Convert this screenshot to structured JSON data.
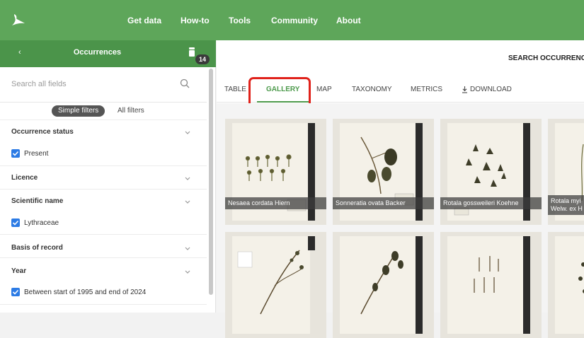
{
  "topnav": {
    "items": [
      "Get data",
      "How-to",
      "Tools",
      "Community",
      "About"
    ]
  },
  "sidebar": {
    "back_glyph": "‹",
    "title": "Occurrences",
    "filter_count": "14",
    "search_placeholder": "Search all fields",
    "tab_simple": "Simple filters",
    "tab_all": "All filters",
    "sections": [
      {
        "title": "Occurrence status",
        "checked_value": "Present"
      },
      {
        "title": "Licence"
      },
      {
        "title": "Scientific name",
        "checked_value": "Lythraceae"
      },
      {
        "title": "Basis of record"
      },
      {
        "title": "Year",
        "checked_value": "Between start of 1995 and end of 2024"
      }
    ]
  },
  "main": {
    "title": "SEARCH OCCURRENCES",
    "tabs": [
      "TABLE",
      "GALLERY",
      "MAP",
      "TAXONOMY",
      "METRICS",
      "DOWNLOAD"
    ],
    "active_tab": "GALLERY",
    "gallery": [
      {
        "caption": "Nesaea cordata Hiern"
      },
      {
        "caption": "Sonneratia ovata Backer"
      },
      {
        "caption": "Rotala gossweileri Koehne"
      },
      {
        "caption": "Rotala myi",
        "caption2": "Welw. ex H"
      },
      {
        "caption": ""
      },
      {
        "caption": ""
      },
      {
        "caption": ""
      },
      {
        "caption": ""
      }
    ]
  },
  "colors": {
    "brand_green": "#5ea65a",
    "active_tab": "#4d9a4c",
    "checkbox": "#2c7be5",
    "highlight": "#e0221b"
  }
}
